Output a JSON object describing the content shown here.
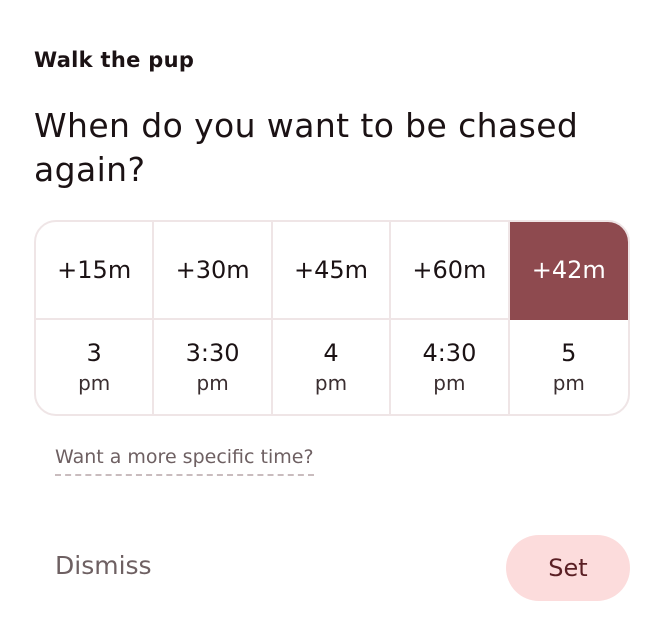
{
  "task": {
    "title": "Walk the pup"
  },
  "question": "When do you want to be chased again?",
  "offsets": [
    {
      "label": "+15m",
      "selected": false
    },
    {
      "label": "+30m",
      "selected": false
    },
    {
      "label": "+45m",
      "selected": false
    },
    {
      "label": "+60m",
      "selected": false
    },
    {
      "label": "+42m",
      "selected": true
    }
  ],
  "times": [
    {
      "time": "3",
      "period": "pm"
    },
    {
      "time": "3:30",
      "period": "pm"
    },
    {
      "time": "4",
      "period": "pm"
    },
    {
      "time": "4:30",
      "period": "pm"
    },
    {
      "time": "5",
      "period": "pm"
    }
  ],
  "specific_link": "Want a more specific time?",
  "actions": {
    "dismiss": "Dismiss",
    "set": "Set"
  },
  "colors": {
    "accent": "#8e4a4f",
    "set_button_bg": "#fcdcdc",
    "border": "#efe5e6"
  }
}
